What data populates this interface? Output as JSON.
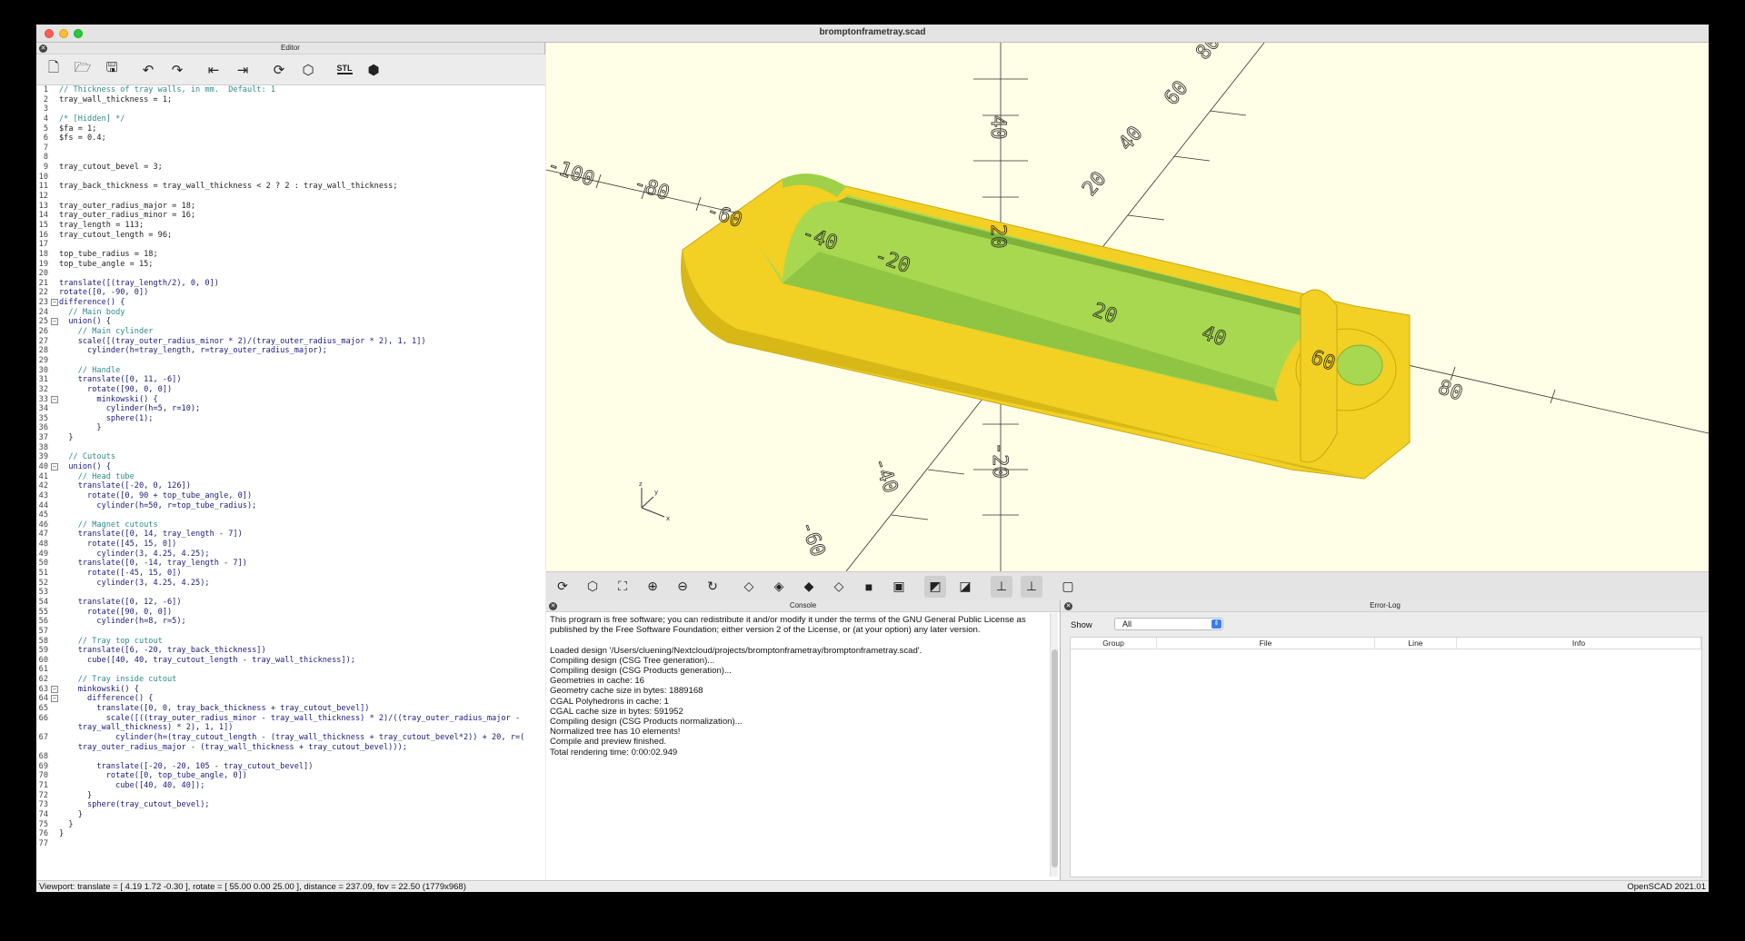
{
  "window": {
    "title": "bromptonframetray.scad"
  },
  "editor": {
    "dock_title": "Editor",
    "toolbar": [
      {
        "name": "new-file-icon",
        "glyph": "🗋"
      },
      {
        "name": "open-file-icon",
        "glyph": "🗁"
      },
      {
        "name": "save-file-icon",
        "glyph": "🖫"
      },
      {
        "name": "undo-icon",
        "glyph": "↶"
      },
      {
        "name": "redo-icon",
        "glyph": "↷"
      },
      {
        "name": "unindent-icon",
        "glyph": "⇤"
      },
      {
        "name": "indent-icon",
        "glyph": "⇥"
      },
      {
        "name": "preview-icon",
        "glyph": "⟳"
      },
      {
        "name": "render-icon",
        "glyph": "⬡"
      },
      {
        "name": "export-stl-icon",
        "glyph": "STL"
      },
      {
        "name": "send-to-print-icon",
        "glyph": "⬢"
      }
    ],
    "lines": [
      {
        "n": "1",
        "t": "// Thickness of tray walls, in mm.  Default: 1",
        "c": "cm"
      },
      {
        "n": "2",
        "t": "tray_wall_thickness = 1;"
      },
      {
        "n": "3",
        "t": ""
      },
      {
        "n": "4",
        "t": "/* [Hidden] */",
        "c": "cm"
      },
      {
        "n": "5",
        "t": "$fa = 1;"
      },
      {
        "n": "6",
        "t": "$fs = 0.4;"
      },
      {
        "n": "7",
        "t": ""
      },
      {
        "n": "8",
        "t": ""
      },
      {
        "n": "9",
        "t": "tray_cutout_bevel = 3;"
      },
      {
        "n": "10",
        "t": ""
      },
      {
        "n": "11",
        "t": "tray_back_thickness = tray_wall_thickness < 2 ? 2 : tray_wall_thickness;"
      },
      {
        "n": "12",
        "t": ""
      },
      {
        "n": "13",
        "t": "tray_outer_radius_major = 18;"
      },
      {
        "n": "14",
        "t": "tray_outer_radius_minor = 16;"
      },
      {
        "n": "15",
        "t": "tray_length = 113;"
      },
      {
        "n": "16",
        "t": "tray_cutout_length = 96;"
      },
      {
        "n": "17",
        "t": ""
      },
      {
        "n": "18",
        "t": "top_tube_radius = 18;"
      },
      {
        "n": "19",
        "t": "top_tube_angle = 15;"
      },
      {
        "n": "20",
        "t": ""
      },
      {
        "n": "21",
        "t": "translate([(tray_length/2), 0, 0])",
        "c": "kw"
      },
      {
        "n": "22",
        "t": "rotate([0, -90, 0])",
        "c": "kw"
      },
      {
        "n": "23",
        "t": "difference() {",
        "c": "kw",
        "f": "−"
      },
      {
        "n": "24",
        "t": "  // Main body",
        "c": "cm"
      },
      {
        "n": "25",
        "t": "  union() {",
        "c": "kw",
        "f": "−"
      },
      {
        "n": "26",
        "t": "    // Main cylinder",
        "c": "cm"
      },
      {
        "n": "27",
        "t": "    scale([(tray_outer_radius_minor * 2)/(tray_outer_radius_major * 2), 1, 1])",
        "c": "kw"
      },
      {
        "n": "28",
        "t": "      cylinder(h=tray_length, r=tray_outer_radius_major);",
        "c": "kw"
      },
      {
        "n": "29",
        "t": ""
      },
      {
        "n": "30",
        "t": "    // Handle",
        "c": "cm"
      },
      {
        "n": "31",
        "t": "    translate([0, 11, -6])",
        "c": "kw"
      },
      {
        "n": "32",
        "t": "      rotate([90, 0, 0])",
        "c": "kw"
      },
      {
        "n": "33",
        "t": "        minkowski() {",
        "c": "kw",
        "f": "−"
      },
      {
        "n": "34",
        "t": "          cylinder(h=5, r=10);",
        "c": "kw"
      },
      {
        "n": "35",
        "t": "          sphere(1);",
        "c": "kw"
      },
      {
        "n": "36",
        "t": "        }"
      },
      {
        "n": "37",
        "t": "  }"
      },
      {
        "n": "38",
        "t": ""
      },
      {
        "n": "39",
        "t": "  // Cutouts",
        "c": "cm"
      },
      {
        "n": "40",
        "t": "  union() {",
        "c": "kw",
        "f": "−"
      },
      {
        "n": "41",
        "t": "    // Head tube",
        "c": "cm"
      },
      {
        "n": "42",
        "t": "    translate([-20, 0, 126])",
        "c": "kw"
      },
      {
        "n": "43",
        "t": "      rotate([0, 90 + top_tube_angle, 0])",
        "c": "kw"
      },
      {
        "n": "44",
        "t": "        cylinder(h=50, r=top_tube_radius);",
        "c": "kw"
      },
      {
        "n": "45",
        "t": ""
      },
      {
        "n": "46",
        "t": "    // Magnet cutouts",
        "c": "cm"
      },
      {
        "n": "47",
        "t": "    translate([0, 14, tray_length - 7])",
        "c": "kw"
      },
      {
        "n": "48",
        "t": "      rotate([45, 15, 0])",
        "c": "kw"
      },
      {
        "n": "49",
        "t": "        cylinder(3, 4.25, 4.25);",
        "c": "kw"
      },
      {
        "n": "50",
        "t": "    translate([0, -14, tray_length - 7])",
        "c": "kw"
      },
      {
        "n": "51",
        "t": "      rotate([-45, 15, 0])",
        "c": "kw"
      },
      {
        "n": "52",
        "t": "        cylinder(3, 4.25, 4.25);",
        "c": "kw"
      },
      {
        "n": "53",
        "t": ""
      },
      {
        "n": "54",
        "t": "    translate([0, 12, -6])",
        "c": "kw"
      },
      {
        "n": "55",
        "t": "      rotate([90, 0, 0])",
        "c": "kw"
      },
      {
        "n": "56",
        "t": "        cylinder(h=8, r=5);",
        "c": "kw"
      },
      {
        "n": "57",
        "t": ""
      },
      {
        "n": "58",
        "t": "    // Tray top cutout",
        "c": "cm"
      },
      {
        "n": "59",
        "t": "    translate([6, -20, tray_back_thickness])",
        "c": "kw"
      },
      {
        "n": "60",
        "t": "      cube([40, 40, tray_cutout_length - tray_wall_thickness]);",
        "c": "kw"
      },
      {
        "n": "61",
        "t": ""
      },
      {
        "n": "62",
        "t": "    // Tray inside cutout",
        "c": "cm"
      },
      {
        "n": "63",
        "t": "    minkowski() {",
        "c": "kw",
        "f": "−"
      },
      {
        "n": "64",
        "t": "      difference() {",
        "c": "kw",
        "f": "−"
      },
      {
        "n": "65",
        "t": "        translate([0, 0, tray_back_thickness + tray_cutout_bevel])",
        "c": "kw"
      },
      {
        "n": "66",
        "t": "          scale([((tray_outer_radius_minor - tray_wall_thickness) * 2)/((tray_outer_radius_major -",
        "c": "kw"
      },
      {
        "n": "",
        "t": "    tray_wall_thickness) * 2), 1, 1])",
        "c": "kw"
      },
      {
        "n": "67",
        "t": "            cylinder(h=(tray_cutout_length - (tray_wall_thickness + tray_cutout_bevel*2)) + 20, r=(",
        "c": "kw"
      },
      {
        "n": "",
        "t": "    tray_outer_radius_major - (tray_wall_thickness + tray_cutout_bevel)));",
        "c": "kw"
      },
      {
        "n": "68",
        "t": ""
      },
      {
        "n": "69",
        "t": "        translate([-20, -20, 105 - tray_cutout_bevel])",
        "c": "kw"
      },
      {
        "n": "70",
        "t": "          rotate([0, top_tube_angle, 0])",
        "c": "kw"
      },
      {
        "n": "71",
        "t": "            cube([40, 40, 40]);",
        "c": "kw"
      },
      {
        "n": "72",
        "t": "      }"
      },
      {
        "n": "73",
        "t": "      sphere(tray_cutout_bevel);",
        "c": "kw"
      },
      {
        "n": "74",
        "t": "    }"
      },
      {
        "n": "75",
        "t": "  }"
      },
      {
        "n": "76",
        "t": "}"
      },
      {
        "n": "77",
        "t": ""
      }
    ]
  },
  "viewport": {
    "axis_labels": [
      "-100",
      "-80",
      "-60",
      "-40",
      "-20",
      "20",
      "40",
      "60",
      "80",
      "40",
      "20",
      "-20",
      "-40",
      "-60",
      "80",
      "60",
      "40",
      "20"
    ],
    "gizmo": {
      "x": "x",
      "y": "y",
      "z": "z"
    },
    "model_colors": {
      "shell": "#f3d324",
      "inner": "#9ed04a",
      "background": "#fffee6"
    }
  },
  "view_toolbar": [
    {
      "name": "preview-icon",
      "glyph": "⟳"
    },
    {
      "name": "render-icon",
      "glyph": "⬡"
    },
    {
      "name": "view-all-icon",
      "glyph": "⛶"
    },
    {
      "name": "zoom-in-icon",
      "glyph": "⊕"
    },
    {
      "name": "zoom-out-icon",
      "glyph": "⊖"
    },
    {
      "name": "reset-view-icon",
      "glyph": "↻"
    },
    {
      "name": "right-view-icon",
      "glyph": "◇"
    },
    {
      "name": "top-view-icon",
      "glyph": "◈"
    },
    {
      "name": "bottom-view-icon",
      "glyph": "◆"
    },
    {
      "name": "left-view-icon",
      "glyph": "◇"
    },
    {
      "name": "front-view-icon",
      "glyph": "■"
    },
    {
      "name": "back-view-icon",
      "glyph": "▣"
    },
    {
      "name": "perspective-icon",
      "glyph": "◩"
    },
    {
      "name": "orthogonal-icon",
      "glyph": "◪"
    },
    {
      "name": "show-axes-icon",
      "glyph": "⊥"
    },
    {
      "name": "show-scale-icon",
      "glyph": "⊥"
    },
    {
      "name": "show-edges-icon",
      "glyph": "▢"
    }
  ],
  "console": {
    "title": "Console",
    "lines": [
      "This program is free software; you can redistribute it and/or modify it under the terms of the GNU General Public License as",
      "published by the Free Software Foundation; either version 2 of the License, or (at your option) any later version.",
      "",
      "Loaded design '/Users/cluening/Nextcloud/projects/bromptonframetray/bromptonframetray.scad'.",
      "Compiling design (CSG Tree generation)...",
      "Compiling design (CSG Products generation)...",
      "Geometries in cache: 16",
      "Geometry cache size in bytes: 1889168",
      "CGAL Polyhedrons in cache: 1",
      "CGAL cache size in bytes: 591952",
      "Compiling design (CSG Products normalization)...",
      "Normalized tree has 10 elements!",
      "Compile and preview finished.",
      "Total rendering time: 0:00:02.949"
    ]
  },
  "errorlog": {
    "title": "Error-Log",
    "show_label": "Show",
    "show_value": "All",
    "columns": [
      "Group",
      "File",
      "Line",
      "Info"
    ]
  },
  "status": {
    "left": "Viewport: translate = [ 4.19 1.72 -0.30 ], rotate = [ 55.00 0.00 25.00 ], distance = 237.09, fov = 22.50 (1779x968)",
    "right": "OpenSCAD 2021.01"
  }
}
